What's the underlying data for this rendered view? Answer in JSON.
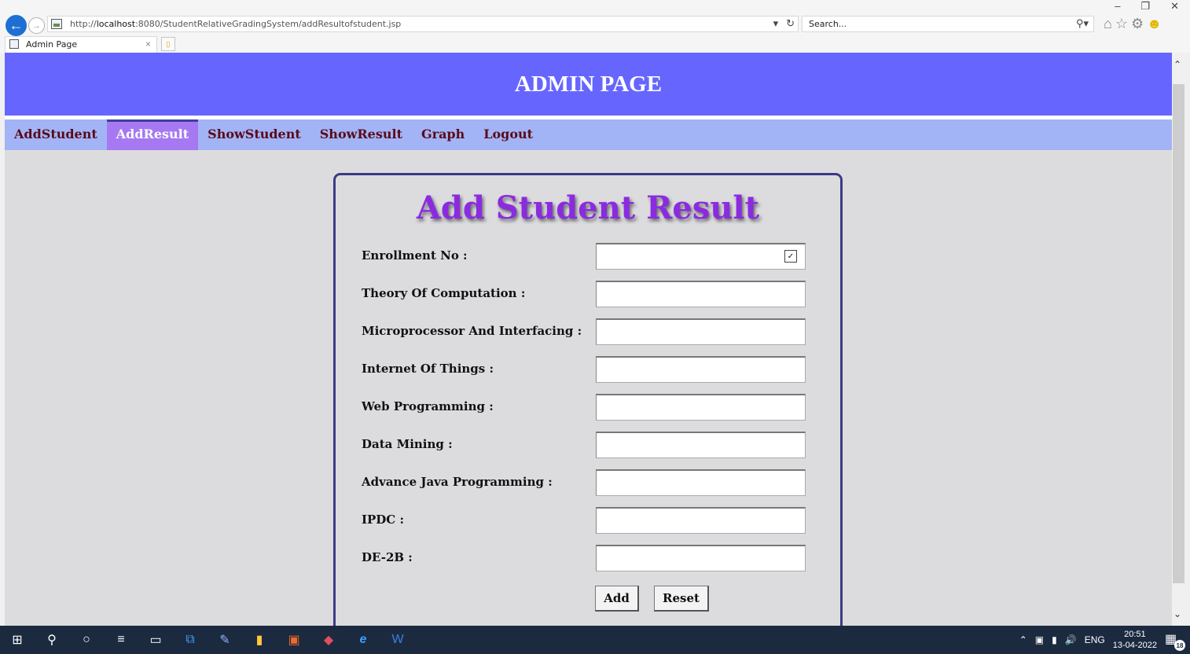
{
  "browser": {
    "url_prefix": "http://",
    "url_host": "localhost",
    "url_rest": ":8080/StudentRelativeGradingSystem/addResultofstudent.jsp",
    "search_placeholder": "Search...",
    "tab_title": "Admin Page"
  },
  "header": {
    "title": "ADMIN PAGE"
  },
  "nav": {
    "items": [
      {
        "label": "AddStudent",
        "active": false
      },
      {
        "label": "AddResult",
        "active": true
      },
      {
        "label": "ShowStudent",
        "active": false
      },
      {
        "label": "ShowResult",
        "active": false
      },
      {
        "label": "Graph",
        "active": false
      },
      {
        "label": "Logout",
        "active": false
      }
    ]
  },
  "form": {
    "title": "Add Student Result",
    "fields": [
      {
        "label": "Enrollment No :",
        "type": "select",
        "value": ""
      },
      {
        "label": "Theory Of Computation :",
        "value": ""
      },
      {
        "label": "Microprocessor And Interfacing :",
        "value": ""
      },
      {
        "label": "Internet Of Things :",
        "value": ""
      },
      {
        "label": "Web Programming :",
        "value": ""
      },
      {
        "label": "Data Mining :",
        "value": ""
      },
      {
        "label": "Advance Java Programming :",
        "value": ""
      },
      {
        "label": "IPDC :",
        "value": ""
      },
      {
        "label": "DE-2B :",
        "value": ""
      }
    ],
    "add_label": "Add",
    "reset_label": "Reset"
  },
  "taskbar": {
    "language": "ENG",
    "time": "20:51",
    "date": "13-04-2022",
    "notifications": "18"
  },
  "colors": {
    "header_bg": "#6666ff",
    "nav_bg": "#a2b4f5",
    "nav_active_bg": "#a679f2",
    "title_color": "#8b2be0",
    "card_border": "#3d3a87"
  }
}
